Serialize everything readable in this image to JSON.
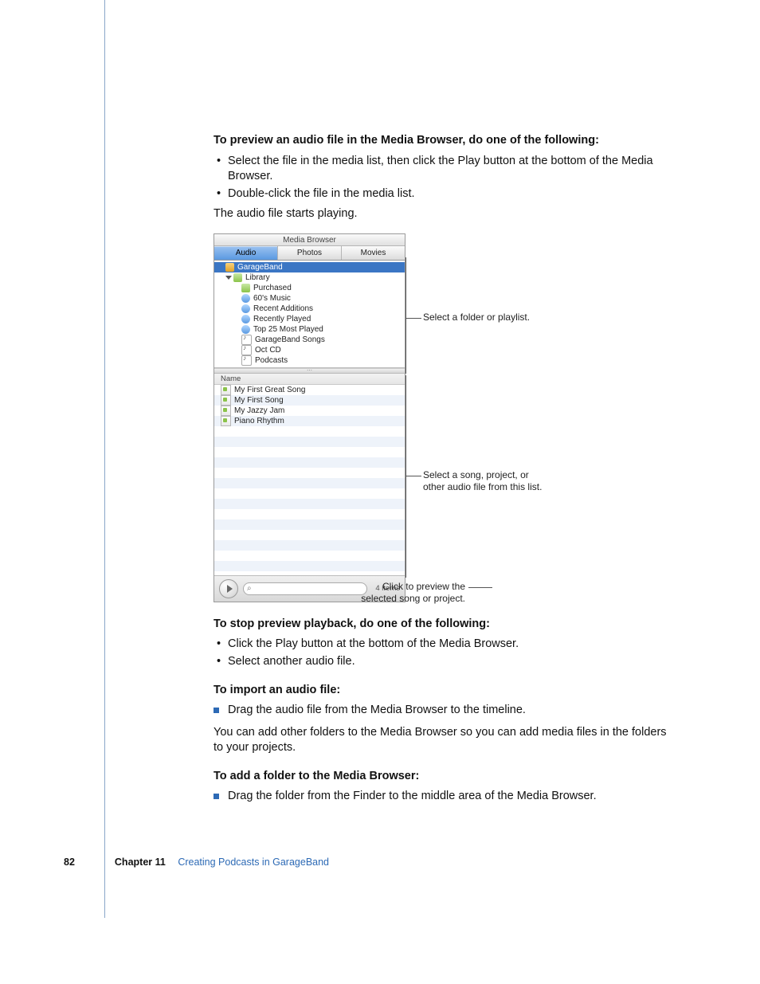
{
  "headings": {
    "preview": "To preview an audio file in the Media Browser, do one of the following:",
    "stop": "To stop preview playback, do one of the following:",
    "import": "To import an audio file:",
    "addfolder": "To add a folder to the Media Browser:"
  },
  "preview_bullets": [
    "Select the file in the media list, then click the Play button at the bottom of the Media Browser.",
    "Double-click the file in the media list."
  ],
  "preview_after": "The audio file starts playing.",
  "stop_bullets": [
    "Click the Play button at the bottom of the Media Browser.",
    "Select another audio file."
  ],
  "import_bullet": "Drag the audio file from the Media Browser to the timeline.",
  "import_after": "You can add other folders to the Media Browser so you can add media files in the folders to your projects.",
  "addfolder_bullet": "Drag the folder from the Finder to the middle area of the Media Browser.",
  "media_browser": {
    "title": "Media Browser",
    "tabs": {
      "audio": "Audio",
      "photos": "Photos",
      "movies": "Movies"
    },
    "tree": {
      "root": "GarageBand",
      "library": "Library",
      "items": [
        "Purchased",
        "60's Music",
        "Recent Additions",
        "Recently Played",
        "Top 25 Most Played",
        "GarageBand Songs",
        "Oct CD",
        "Podcasts"
      ]
    },
    "list": {
      "header": "Name",
      "rows": [
        "My First Great Song",
        "My First Song",
        "My Jazzy Jam",
        "Piano Rhythm"
      ]
    },
    "footer": {
      "count": "4 items"
    }
  },
  "callouts": {
    "folder": "Select a folder or playlist.",
    "song1": "Select a song, project, or",
    "song2": "other audio file from this list.",
    "play1": "Click to preview the",
    "play2": "selected song or project."
  },
  "page_footer": {
    "number": "82",
    "chapter_label": "Chapter 11",
    "chapter_title": "Creating Podcasts in GarageBand"
  }
}
